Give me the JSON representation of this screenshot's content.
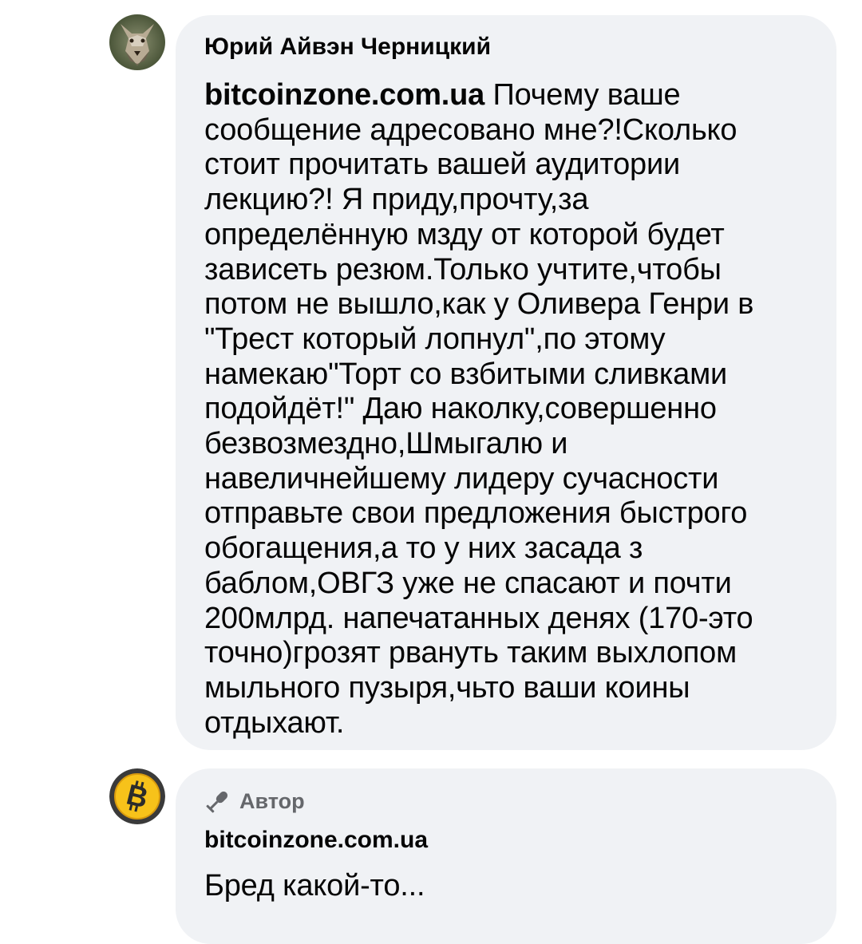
{
  "comments": [
    {
      "author": "Юрий Айвэн Черницкий",
      "mention": "bitcoinzone.com.ua",
      "text_lines": [
        " Почему ваше",
        "сообщение адресовано мне?!Сколько",
        "стоит прочитать вашей аудитории",
        "лекцию?! Я приду,прочту,за",
        "определённую мзду от которой будет",
        "зависеть резюм.Только учтите,чтобы",
        "потом не вышло,как у Оливера Генри в",
        "\"Трест который лопнул\",по этому",
        "намекаю\"Торт со взбитыми сливками",
        "подойдёт!\" Даю наколку,совершенно",
        "безвозмездно,Шмыгалю и",
        "навеличнейшему лидеру сучасности",
        "отправьте свои предложения быстрого",
        "обогащения,а то у них засада з",
        "баблом,ОВГЗ уже не спасают и почти",
        "200млрд. напечатанных денях (170-это",
        "точно)грозят рвануть таким выхлопом",
        "мыльного пузыря,чьто ваши коины",
        "отдыхают."
      ],
      "avatar_icon": "wolf-avatar"
    },
    {
      "badge": "Автор",
      "badge_icon": "microphone-icon",
      "author": "bitcoinzone.com.ua",
      "text": "Бред какой-то...",
      "avatar_icon": "bitcoin-logo"
    }
  ],
  "colors": {
    "bubble": "#f0f2f5",
    "text": "#050505",
    "secondary": "#65676b",
    "bitcoin": "#f7931a"
  }
}
